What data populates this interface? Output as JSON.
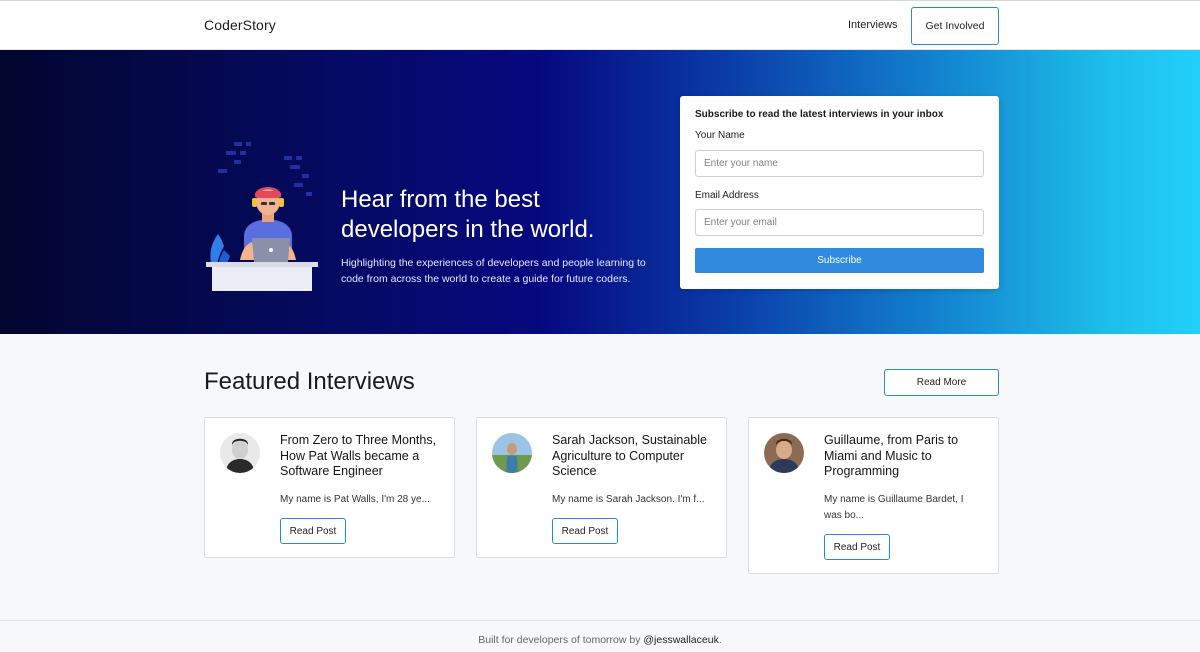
{
  "nav": {
    "brand": "CoderStory",
    "links": [
      "Interviews"
    ],
    "cta": "Get Involved"
  },
  "hero": {
    "title": "Hear from the best developers in the world.",
    "subtitle": "Highlighting the experiences of developers and people learning to code from across the world to create a guide for future coders."
  },
  "subscribe": {
    "heading": "Subscribe to read the latest interviews in your inbox",
    "name_label": "Your Name",
    "name_placeholder": "Enter your name",
    "email_label": "Email Address",
    "email_placeholder": "Enter your email",
    "button": "Subscribe"
  },
  "featured": {
    "title": "Featured Interviews",
    "more_button": "Read More",
    "cards": [
      {
        "title": "From Zero to Three Months, How Pat Walls became a Software Engineer",
        "excerpt": "My name is Pat Walls, I'm 28 ye...",
        "button": "Read Post"
      },
      {
        "title": "Sarah Jackson, Sustainable Agriculture to Computer Science",
        "excerpt": "My name is Sarah Jackson.  I'm f...",
        "button": "Read Post"
      },
      {
        "title": "Guillaume, from Paris to Miami and Music to Programming",
        "excerpt": "My name is Guillaume Bardet, I was bo...",
        "button": "Read Post"
      }
    ]
  },
  "footer": {
    "text": "Built for developers of tomorrow by ",
    "handle": "@jesswallaceuk",
    "suffix": "."
  },
  "colors": {
    "accent": "#2b8ad6",
    "subscribe_button": "#2f8ae0",
    "hero_gradient_start": "#03062e",
    "hero_gradient_end": "#22d0fb"
  }
}
